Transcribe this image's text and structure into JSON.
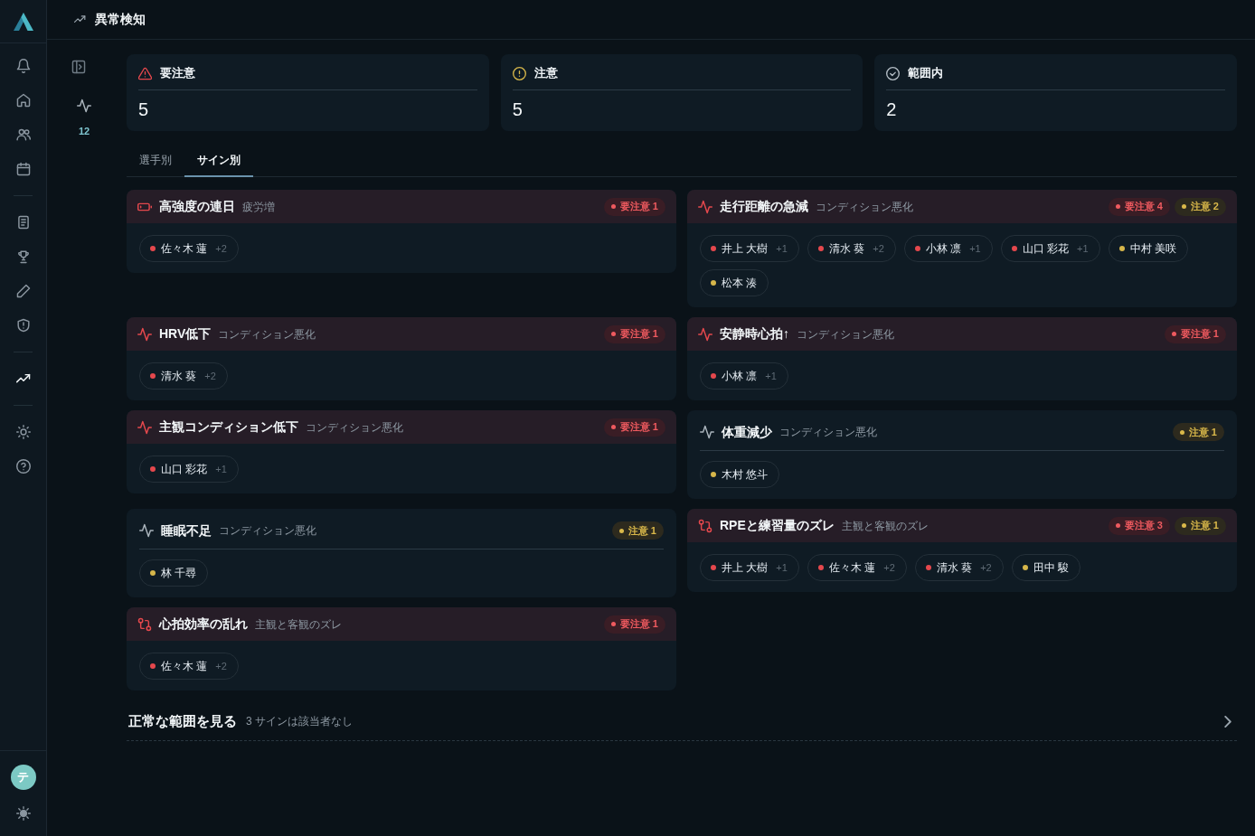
{
  "sidebar": {
    "groups": [
      {
        "items": [
          {
            "selected": false
          },
          {
            "selected": false
          },
          {
            "selected": false
          },
          {
            "selected": false
          }
        ]
      },
      {
        "items": [
          {
            "selected": false
          },
          {
            "selected": false
          },
          {
            "selected": false
          },
          {
            "selected": false
          }
        ]
      },
      {
        "items": [
          {
            "selected": true
          }
        ]
      },
      {
        "items": [
          {
            "selected": false
          },
          {
            "selected": false
          }
        ]
      }
    ],
    "user": {
      "initial": "テ"
    }
  },
  "header": {
    "title": "異常検知"
  },
  "subnav": {
    "count": "12"
  },
  "summary": [
    {
      "kind": "alert",
      "label": "要注意",
      "value": "5"
    },
    {
      "kind": "caution",
      "label": "注意",
      "value": "5"
    },
    {
      "kind": "ok",
      "label": "範囲内",
      "value": "2"
    }
  ],
  "tabs": [
    {
      "label": "選手別",
      "selected": false
    },
    {
      "label": "サイン別",
      "selected": true
    }
  ],
  "signs": [
    {
      "kind": "fatigue",
      "highlighted": true,
      "title": "高強度の連日",
      "category": "疲労増",
      "badges": [
        {
          "kind": "alert",
          "label": "要注意 1"
        }
      ],
      "athletes": [
        {
          "name": "佐々木 蓮",
          "extra": "+2",
          "color": "#e5484d"
        }
      ]
    },
    {
      "kind": "condition",
      "highlighted": true,
      "title": "走行距離の急減",
      "category": "コンディション悪化",
      "badges": [
        {
          "kind": "alert",
          "label": "要注意 4"
        },
        {
          "kind": "caution",
          "label": "注意 2"
        }
      ],
      "athletes": [
        {
          "name": "井上 大樹",
          "extra": "+1",
          "color": "#e5484d"
        },
        {
          "name": "清水 葵",
          "extra": "+2",
          "color": "#e5484d"
        },
        {
          "name": "小林 凛",
          "extra": "+1",
          "color": "#e5484d"
        },
        {
          "name": "山口 彩花",
          "extra": "+1",
          "color": "#e5484d"
        },
        {
          "name": "中村 美咲",
          "color": "#d6b64a"
        },
        {
          "name": "松本 湊",
          "color": "#d6b64a"
        }
      ]
    },
    {
      "kind": "condition",
      "highlighted": true,
      "title": "HRV低下",
      "category": "コンディション悪化",
      "badges": [
        {
          "kind": "alert",
          "label": "要注意 1"
        }
      ],
      "athletes": [
        {
          "name": "清水 葵",
          "extra": "+2",
          "color": "#e5484d"
        }
      ]
    },
    {
      "kind": "condition",
      "highlighted": true,
      "title": "安静時心拍↑",
      "category": "コンディション悪化",
      "badges": [
        {
          "kind": "alert",
          "label": "要注意 1"
        }
      ],
      "athletes": [
        {
          "name": "小林 凛",
          "extra": "+1",
          "color": "#e5484d"
        }
      ]
    },
    {
      "kind": "condition",
      "highlighted": true,
      "title": "主観コンディション低下",
      "category": "コンディション悪化",
      "badges": [
        {
          "kind": "alert",
          "label": "要注意 1"
        }
      ],
      "athletes": [
        {
          "name": "山口 彩花",
          "extra": "+1",
          "color": "#e5484d"
        }
      ]
    },
    {
      "kind": "condition",
      "highlighted": false,
      "title": "体重減少",
      "category": "コンディション悪化",
      "badges": [
        {
          "kind": "caution",
          "label": "注意 1"
        }
      ],
      "athletes": [
        {
          "name": "木村 悠斗",
          "color": "#d6b64a"
        }
      ]
    },
    {
      "kind": "condition",
      "highlighted": false,
      "title": "睡眠不足",
      "category": "コンディション悪化",
      "badges": [
        {
          "kind": "caution",
          "label": "注意 1"
        }
      ],
      "athletes": [
        {
          "name": "林 千尋",
          "color": "#d6b64a"
        }
      ]
    },
    {
      "kind": "gap",
      "highlighted": true,
      "title": "RPEと練習量のズレ",
      "category": "主観と客観のズレ",
      "badges": [
        {
          "kind": "alert",
          "label": "要注意 3"
        },
        {
          "kind": "caution",
          "label": "注意 1"
        }
      ],
      "athletes": [
        {
          "name": "井上 大樹",
          "extra": "+1",
          "color": "#e5484d"
        },
        {
          "name": "佐々木 蓮",
          "extra": "+2",
          "color": "#e5484d"
        },
        {
          "name": "清水 葵",
          "extra": "+2",
          "color": "#e5484d"
        },
        {
          "name": "田中 駿",
          "color": "#d6b64a"
        }
      ]
    },
    {
      "kind": "gap",
      "highlighted": true,
      "title": "心拍効率の乱れ",
      "category": "主観と客観のズレ",
      "badges": [
        {
          "kind": "alert",
          "label": "要注意 1"
        }
      ],
      "athletes": [
        {
          "name": "佐々木 蓮",
          "extra": "+2",
          "color": "#e5484d"
        }
      ]
    }
  ],
  "footer": {
    "title": "正常な範囲を見る",
    "note": "3 サインは該当者なし"
  }
}
